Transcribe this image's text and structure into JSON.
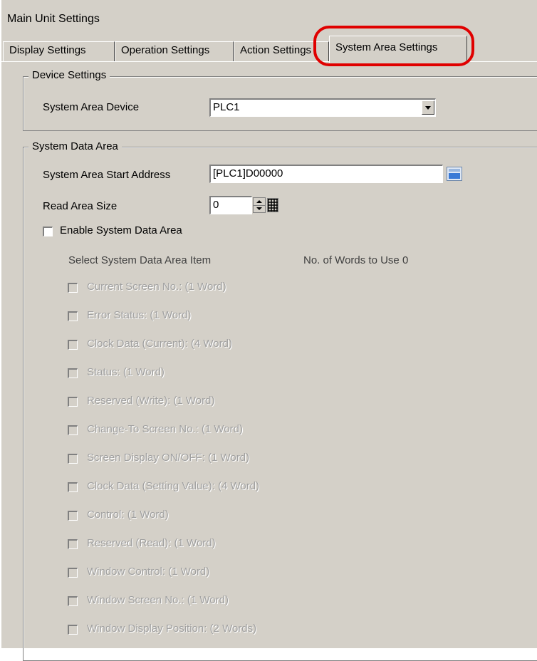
{
  "window": {
    "title": "Main Unit Settings"
  },
  "tabs": [
    {
      "label": "Display Settings"
    },
    {
      "label": "Operation Settings"
    },
    {
      "label": "Action Settings"
    },
    {
      "label": "System Area Settings"
    }
  ],
  "device_settings": {
    "group_title": "Device Settings",
    "system_area_device_label": "System Area Device",
    "system_area_device_value": "PLC1"
  },
  "system_data_area": {
    "group_title": "System Data Area",
    "start_address_label": "System Area Start Address",
    "start_address_value": "[PLC1]D00000",
    "read_area_size_label": "Read Area Size",
    "read_area_size_value": "0",
    "enable_label": "Enable System Data Area",
    "select_items_label": "Select System Data Area Item",
    "words_to_use_label": "No. of Words to Use 0",
    "items": [
      {
        "label": "Current Screen No.: (1 Word)"
      },
      {
        "label": "Error Status: (1 Word)"
      },
      {
        "label": "Clock Data (Current): (4 Word)"
      },
      {
        "label": "Status: (1 Word)"
      },
      {
        "label": "Reserved (Write): (1 Word)"
      },
      {
        "label": "Change-To Screen No.: (1 Word)"
      },
      {
        "label": "Screen Display ON/OFF: (1 Word)"
      },
      {
        "label": "Clock Data (Setting Value): (4 Word)"
      },
      {
        "label": "Control: (1 Word)"
      },
      {
        "label": "Reserved (Read): (1 Word)"
      },
      {
        "label": "Window Control: (1 Word)"
      },
      {
        "label": "Window Screen No.: (1 Word)"
      },
      {
        "label": "Window Display Position: (2 Words)"
      }
    ]
  },
  "colors": {
    "highlight": "#e00000",
    "dialog_bg": "#d4d0c8"
  }
}
